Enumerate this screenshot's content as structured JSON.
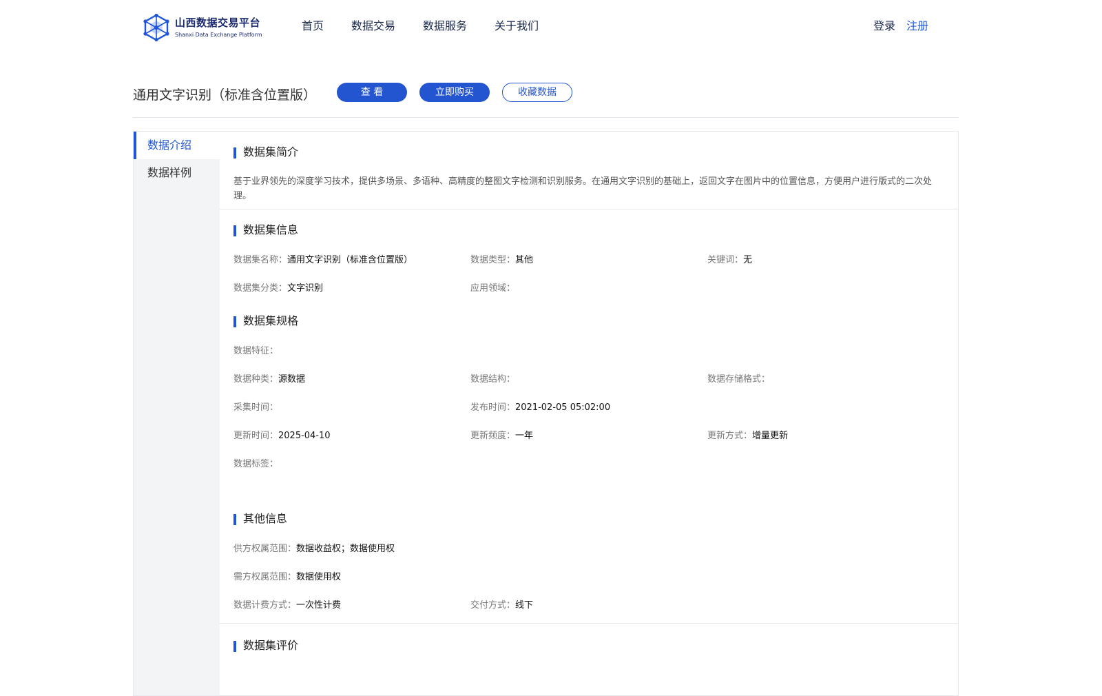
{
  "brand": {
    "name_cn": "山西数据交易平台",
    "name_en": "Shanxi Data Exchange Platform"
  },
  "nav": [
    "首页",
    "数据交易",
    "数据服务",
    "关于我们"
  ],
  "auth": {
    "login": "登录",
    "register": "注册"
  },
  "title": "通用文字识别（标准含位置版）",
  "actions": {
    "view": "查 看",
    "buy": "立即购买",
    "favorite": "收藏数据"
  },
  "sidebar": [
    "数据介绍",
    "数据样例"
  ],
  "intro": {
    "title": "数据集简介",
    "text": "基于业界领先的深度学习技术，提供多场景、多语种、高精度的整图文字检测和识别服务。在通用文字识别的基础上，返回文字在图片中的位置信息，方便用户进行版式的二次处理。"
  },
  "info": {
    "title": "数据集信息",
    "fields": [
      {
        "label": "数据集名称：",
        "value": "通用文字识别（标准含位置版）"
      },
      {
        "label": "数据类型：",
        "value": "其他"
      },
      {
        "label": "关键词：",
        "value": "无"
      },
      {
        "label": "数据集分类：",
        "value": "文字识别"
      },
      {
        "label": "应用领域：",
        "value": ""
      }
    ]
  },
  "spec": {
    "title": "数据集规格",
    "feature": {
      "label": "数据特征：",
      "value": ""
    },
    "fields": [
      {
        "label": "数据种类：",
        "value": "源数据"
      },
      {
        "label": "数据结构：",
        "value": ""
      },
      {
        "label": "数据存储格式：",
        "value": ""
      },
      {
        "label": "采集时间：",
        "value": ""
      },
      {
        "label": "发布时间：",
        "value": "2021-02-05 05:02:00"
      },
      {
        "label": "",
        "value": ""
      },
      {
        "label": "更新时间：",
        "value": "2025-04-10"
      },
      {
        "label": "更新频度：",
        "value": "一年"
      },
      {
        "label": "更新方式：",
        "value": "增量更新"
      }
    ],
    "tags": {
      "label": "数据标签：",
      "value": ""
    }
  },
  "other": {
    "title": "其他信息",
    "supply": {
      "label": "供方权属范围：",
      "value": "数据收益权；数据使用权"
    },
    "demand": {
      "label": "需方权属范围：",
      "value": "数据使用权"
    },
    "fields": [
      {
        "label": "数据计费方式：",
        "value": "一次性计费"
      },
      {
        "label": "交付方式：",
        "value": "线下"
      }
    ]
  },
  "review": {
    "title": "数据集评价"
  },
  "colors": {
    "accent": "#1f55d6",
    "button": "#2355d0",
    "sidebar_bg": "#f3f4f6"
  }
}
